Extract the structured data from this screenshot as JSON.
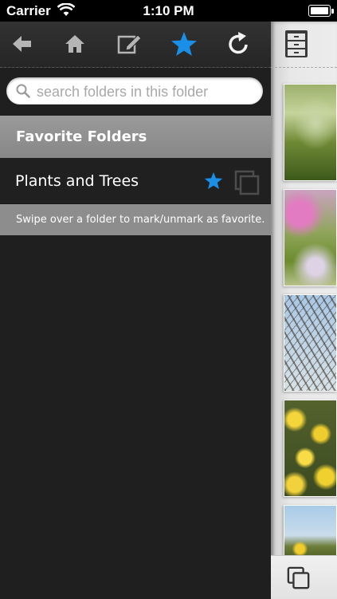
{
  "status_bar": {
    "carrier": "Carrier",
    "time": "1:10 PM"
  },
  "toolbar": {
    "icons": [
      "back-arrow-icon",
      "home-icon",
      "edit-icon",
      "star-icon",
      "refresh-icon"
    ],
    "active_color": "#1a8fe8"
  },
  "search": {
    "placeholder": "search folders in this folder",
    "value": ""
  },
  "section": {
    "title": "Favorite Folders"
  },
  "folders": [
    {
      "name": "Plants and Trees",
      "favorite": true
    }
  ],
  "hint": {
    "text": "Swipe over a folder to mark/unmark as favorite."
  },
  "strip": {
    "top_icon": "file-cabinet-icon",
    "bottom_icon": "copy-icon",
    "thumbnails": [
      "grass-photo",
      "pink-flower-photo",
      "tree-branches-photo",
      "yellow-daisies-photo",
      "sky-flowers-photo"
    ]
  }
}
